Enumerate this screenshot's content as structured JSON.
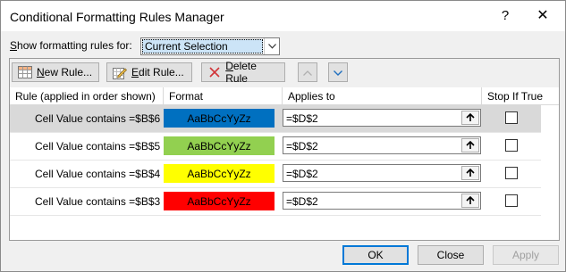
{
  "window": {
    "title": "Conditional Formatting Rules Manager",
    "help": "?",
    "close": "✕"
  },
  "show_rules": {
    "label_pre": "S",
    "label_rest": "how formatting rules for:",
    "selected": "Current Selection"
  },
  "toolbar": {
    "new_rule": {
      "u": "N",
      "rest": "ew Rule..."
    },
    "edit_rule": {
      "u": "E",
      "rest": "dit Rule..."
    },
    "delete_rule": {
      "u": "D",
      "rest": "elete Rule"
    }
  },
  "columns": {
    "rule": "Rule (applied in order shown)",
    "format": "Format",
    "applies": "Applies to",
    "stop": "Stop If True"
  },
  "rules": [
    {
      "rule": "Cell Value contains =$B$6",
      "preview": "AaBbCcYyZz",
      "bg": "#0070c0",
      "fg": "#000000",
      "applies": "=$D$2",
      "stop": false,
      "selected": true
    },
    {
      "rule": "Cell Value contains =$B$5",
      "preview": "AaBbCcYyZz",
      "bg": "#92d050",
      "fg": "#000000",
      "applies": "=$D$2",
      "stop": false,
      "selected": false
    },
    {
      "rule": "Cell Value contains =$B$4",
      "preview": "AaBbCcYyZz",
      "bg": "#ffff00",
      "fg": "#000000",
      "applies": "=$D$2",
      "stop": false,
      "selected": false
    },
    {
      "rule": "Cell Value contains =$B$3",
      "preview": "AaBbCcYyZz",
      "bg": "#ff0000",
      "fg": "#000000",
      "applies": "=$D$2",
      "stop": false,
      "selected": false
    }
  ],
  "buttons": {
    "ok": "OK",
    "close": "Close",
    "apply": "Apply"
  }
}
